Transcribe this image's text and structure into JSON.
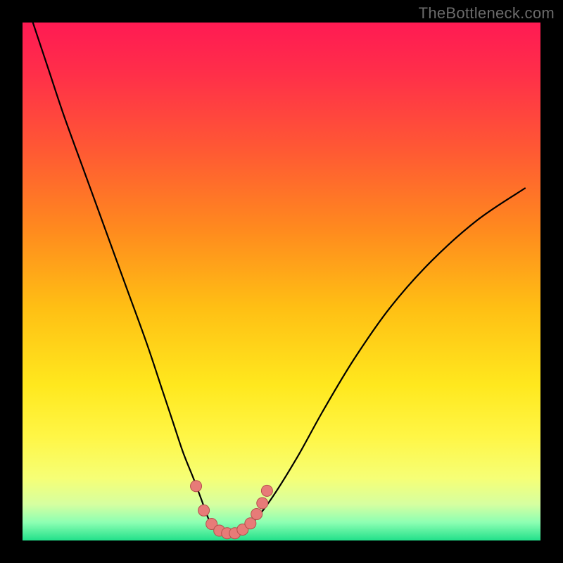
{
  "watermark": "TheBottleneck.com",
  "colors": {
    "frame": "#000000",
    "gradient_stops": [
      {
        "offset": 0.0,
        "color": "#ff1a53"
      },
      {
        "offset": 0.1,
        "color": "#ff2f49"
      },
      {
        "offset": 0.25,
        "color": "#ff5a33"
      },
      {
        "offset": 0.4,
        "color": "#ff8a1e"
      },
      {
        "offset": 0.55,
        "color": "#ffbf14"
      },
      {
        "offset": 0.7,
        "color": "#ffe81e"
      },
      {
        "offset": 0.8,
        "color": "#fff646"
      },
      {
        "offset": 0.88,
        "color": "#f6ff76"
      },
      {
        "offset": 0.93,
        "color": "#d6ffa0"
      },
      {
        "offset": 0.965,
        "color": "#8dffb3"
      },
      {
        "offset": 1.0,
        "color": "#22e08a"
      }
    ],
    "curve": "#000000",
    "marker_fill": "#e77b78",
    "marker_stroke": "#b54f4c"
  },
  "chart_data": {
    "type": "line",
    "title": "",
    "xlabel": "",
    "ylabel": "",
    "xlim": [
      0,
      100
    ],
    "ylim": [
      0,
      100
    ],
    "series": [
      {
        "name": "bottleneck-curve",
        "x": [
          2,
          5,
          8,
          12,
          16,
          20,
          24,
          27,
          29,
          31,
          33,
          34.5,
          36,
          37.5,
          39,
          41,
          44,
          48,
          53,
          58,
          64,
          71,
          79,
          88,
          97
        ],
        "y": [
          100,
          91,
          82,
          71,
          60,
          49,
          38,
          29,
          23,
          17,
          12,
          8,
          4,
          2,
          1,
          1,
          3,
          8,
          16,
          25,
          35,
          45,
          54,
          62,
          68
        ]
      }
    ],
    "markers": {
      "name": "highlight-points",
      "x": [
        33.5,
        35,
        36.5,
        38,
        39.5,
        41,
        42.5,
        44,
        45.2,
        46.3,
        47.2
      ],
      "y": [
        10.5,
        5.8,
        3.2,
        1.9,
        1.4,
        1.4,
        2.1,
        3.3,
        5.1,
        7.2,
        9.6
      ]
    }
  }
}
